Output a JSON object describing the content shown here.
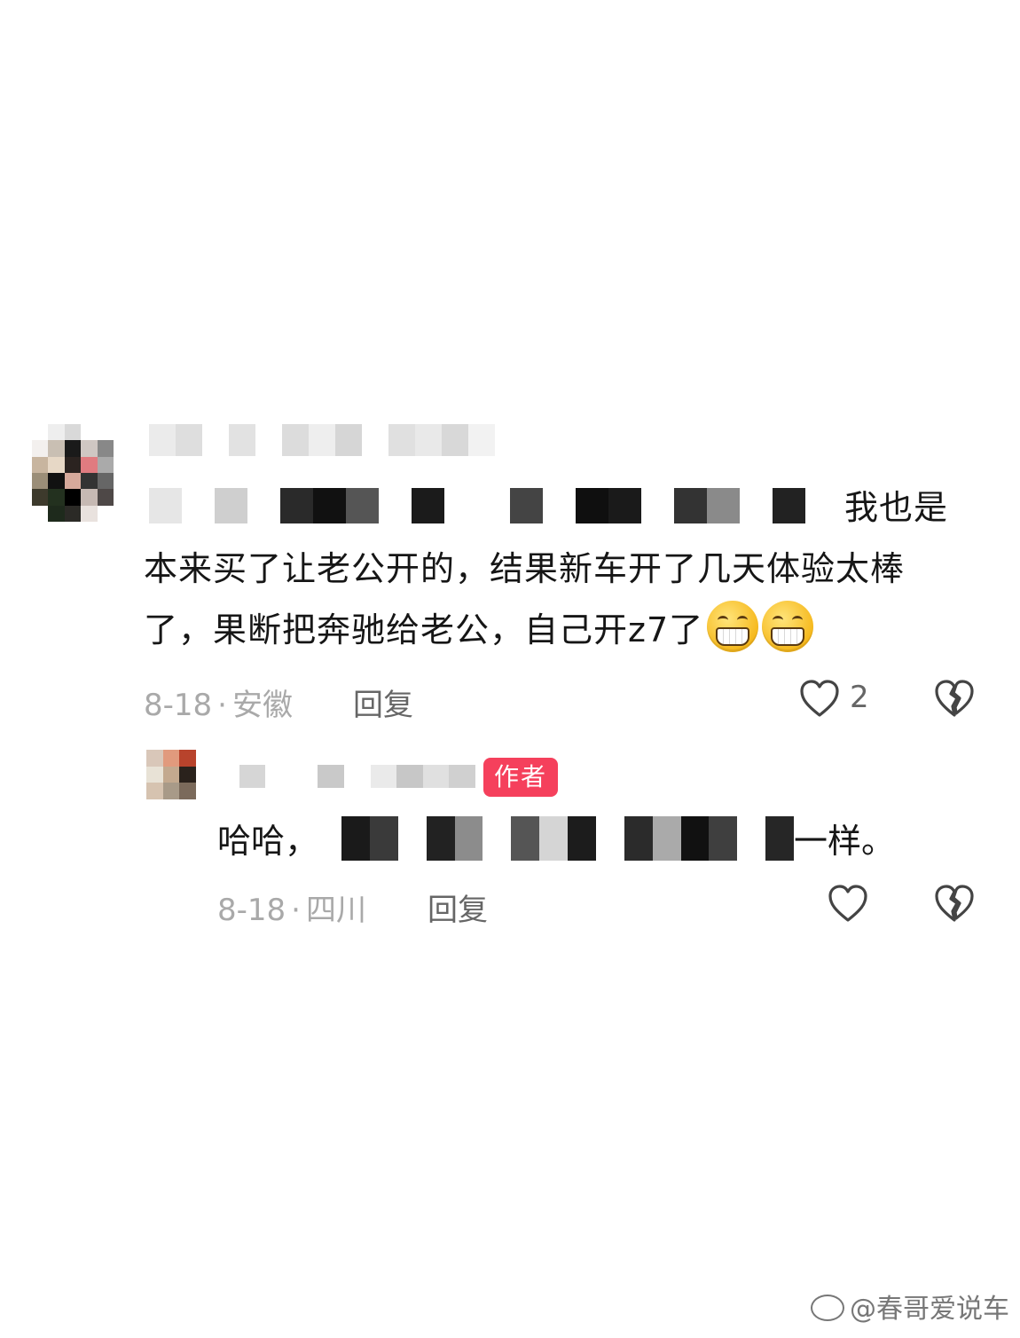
{
  "comment": {
    "text_start": "我也是本来买了让老公开的，结果新车开了几天体验太棒了，果断把奔驰给老公，自己开z7了",
    "date": "8-18",
    "location": "安徽",
    "reply_label": "回复",
    "like_count": "2",
    "emoji_name": "grinning-face"
  },
  "reply": {
    "badge": "作者",
    "text_prefix": "哈哈，",
    "text_suffix": "一样。",
    "date": "8-18",
    "location": "四川",
    "reply_label": "回复"
  },
  "watermark": "@春哥爱说车",
  "colors": {
    "badge_bg": "#f5405c",
    "meta_text": "#a9a9a9"
  }
}
